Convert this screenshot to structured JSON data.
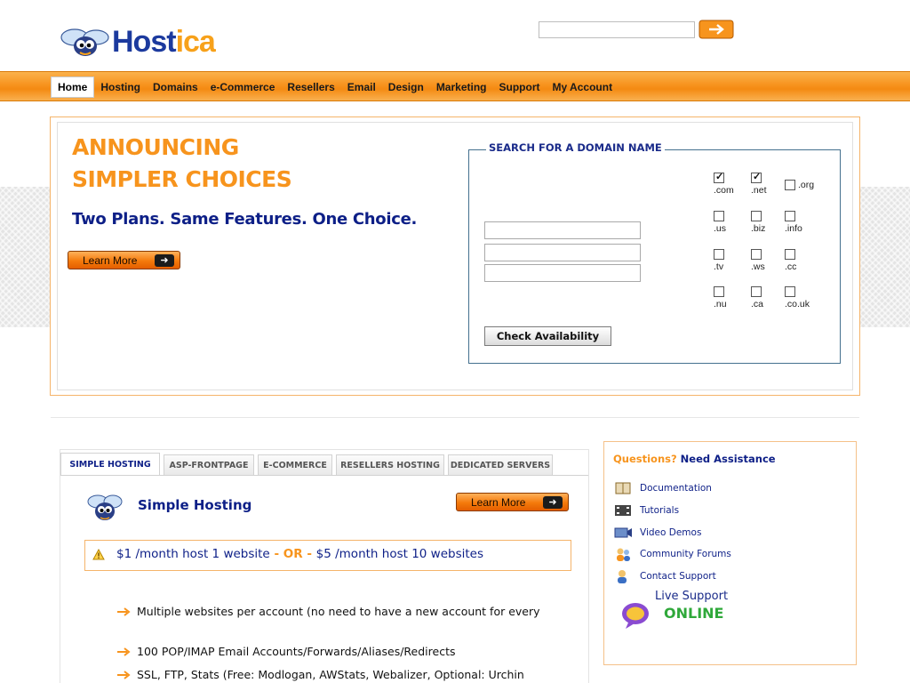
{
  "brand": {
    "name_part1": "Host",
    "name_part2": "ica"
  },
  "top_search": {
    "value": "",
    "placeholder": ""
  },
  "nav": {
    "items": [
      {
        "label": "Home",
        "active": true
      },
      {
        "label": "Hosting"
      },
      {
        "label": "Domains"
      },
      {
        "label": "e-Commerce"
      },
      {
        "label": "Resellers"
      },
      {
        "label": "Email"
      },
      {
        "label": "Design"
      },
      {
        "label": "Marketing"
      },
      {
        "label": "Support"
      },
      {
        "label": "My Account"
      }
    ]
  },
  "hero": {
    "title_line1": "ANNOUNCING",
    "title_line2": "SIMPLER CHOICES",
    "subtitle": "Two Plans. Same Features. One Choice.",
    "learn_more": "Learn More",
    "arrow": "➜"
  },
  "domain_search": {
    "heading": "SEARCH FOR A DOMAIN NAME",
    "inputs": [
      "",
      "",
      ""
    ],
    "check_label": "Check Availability",
    "tlds": [
      {
        "label": ".com",
        "checked": true
      },
      {
        "label": ".net",
        "checked": true
      },
      {
        "label": ".org",
        "checked": false
      },
      {
        "label": ".us",
        "checked": false
      },
      {
        "label": ".biz",
        "checked": false
      },
      {
        "label": ".info",
        "checked": false
      },
      {
        "label": ".tv",
        "checked": false
      },
      {
        "label": ".ws",
        "checked": false
      },
      {
        "label": ".cc",
        "checked": false
      },
      {
        "label": ".nu",
        "checked": false
      },
      {
        "label": ".ca",
        "checked": false
      },
      {
        "label": ".co.uk",
        "checked": false
      }
    ]
  },
  "hosting": {
    "tabs": [
      "SIMPLE HOSTING",
      "ASP-FRONTPAGE",
      "E-COMMERCE",
      "RESELLERS HOSTING",
      "DEDICATED SERVERS"
    ],
    "title": "Simple Hosting",
    "learn_more": "Learn More",
    "price_a": "$1 /month host 1 website",
    "price_or": " - OR - ",
    "price_b": "$5 /month host 10 websites",
    "features": [
      "Multiple websites per account (no need to have a new account for every",
      "100 POP/IMAP Email Accounts/Forwards/Aliases/Redirects",
      "SSL, FTP, Stats (Free: Modlogan, AWStats, Webalizer, Optional: Urchin"
    ]
  },
  "assistance": {
    "title_q": "Questions?",
    "title_rest": " Need Assistance",
    "links": [
      "Documentation",
      "Tutorials",
      "Video Demos",
      "Community Forums",
      "Contact Support"
    ],
    "live_line1": "Live Support",
    "live_line2": "ONLINE"
  },
  "colors": {
    "accent_orange": "#f7941d",
    "navy": "#0d1f87",
    "online_green": "#2fa83a"
  }
}
